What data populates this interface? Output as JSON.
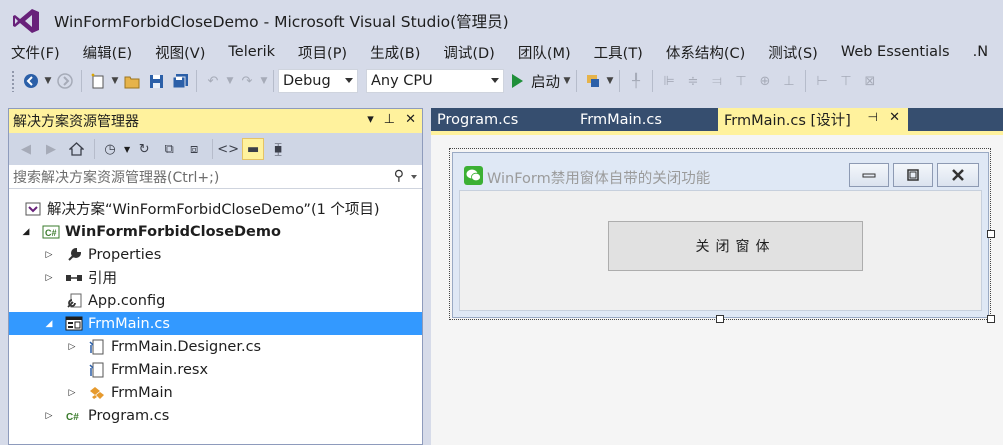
{
  "window": {
    "title": "WinFormForbidCloseDemo - Microsoft Visual Studio(管理员)"
  },
  "menu": [
    "文件(F)",
    "编辑(E)",
    "视图(V)",
    "Telerik",
    "项目(P)",
    "生成(B)",
    "调试(D)",
    "团队(M)",
    "工具(T)",
    "体系结构(C)",
    "测试(S)",
    "Web Essentials",
    ".N"
  ],
  "toolbar": {
    "config": "Debug",
    "platform": "Any CPU",
    "start_label": "启动"
  },
  "solution_explorer": {
    "title": "解决方案资源管理器",
    "search_placeholder": "搜索解决方案资源管理器(Ctrl+;)",
    "tree": [
      {
        "label": "解决方案“WinFormForbidCloseDemo”(1 个项目)"
      },
      {
        "label": "WinFormForbidCloseDemo"
      },
      {
        "label": "Properties"
      },
      {
        "label": "引用"
      },
      {
        "label": "App.config"
      },
      {
        "label": "FrmMain.cs"
      },
      {
        "label": "FrmMain.Designer.cs"
      },
      {
        "label": "FrmMain.resx"
      },
      {
        "label": "FrmMain"
      },
      {
        "label": "Program.cs"
      }
    ]
  },
  "tabs": [
    {
      "label": "Program.cs"
    },
    {
      "label": "FrmMain.cs"
    },
    {
      "label": "FrmMain.cs [设计]"
    }
  ],
  "designer": {
    "form_title": "WinForm禁用窗体自带的关闭功能",
    "button_label": "关闭窗体"
  },
  "colors": {
    "accent_yellow": "#fff29d",
    "selection_blue": "#3399ff",
    "tabstrip": "#364e6f",
    "vs_purple": "#68217a"
  }
}
